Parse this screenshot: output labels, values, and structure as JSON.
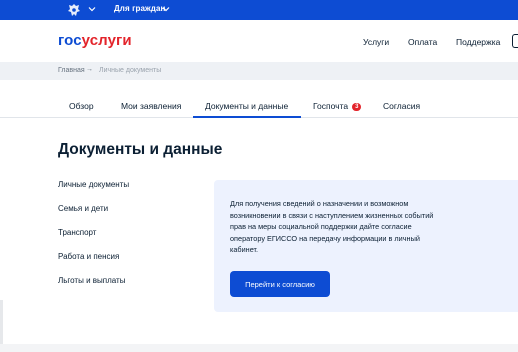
{
  "topbar": {
    "emblem_icon": "coat-of-arms-icon",
    "audience": "Для граждан",
    "color": "#0d4cd3"
  },
  "header": {
    "logo_part1": "гос",
    "logo_part2": "услуги",
    "nav": [
      "Услуги",
      "Оплата",
      "Поддержка"
    ]
  },
  "breadcrumb": {
    "home": "Главная",
    "separator": "→",
    "current": "Личные документы"
  },
  "tabs": {
    "items": [
      "Обзор",
      "Мои заявления",
      "Документы и данные",
      "Госпочта",
      "Согласия"
    ],
    "active": "Документы и данные",
    "mail_badge": "3"
  },
  "page": {
    "title": "Документы и данные"
  },
  "sidebar": {
    "items": [
      "Личные документы",
      "Семья и дети",
      "Транспорт",
      "Работа и пенсия",
      "Льготы и выплаты"
    ]
  },
  "consent_panel": {
    "text": "Для получения сведений о назначении и возможном возникновении в связи с наступлением жизненных событий прав на меры социальной поддержки дайте согласие оператору ЕГИССО на передачу информации в личный кабинет.",
    "button_label": "Перейти к согласию"
  }
}
